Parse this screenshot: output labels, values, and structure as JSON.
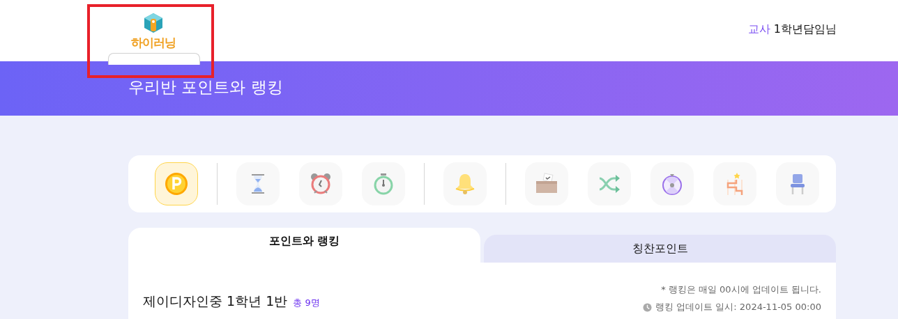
{
  "header": {
    "logo_text": "하이러닝",
    "role": "교사",
    "user": "1학년담임님"
  },
  "annotation": {
    "kind": "highlight-frame"
  },
  "banner": {
    "title": "우리반 포인트와 랭킹"
  },
  "tool_groups": [
    [
      {
        "kind": "point",
        "selected": true
      }
    ],
    [
      {
        "kind": "hourglass",
        "selected": false
      },
      {
        "kind": "alarm",
        "selected": false
      },
      {
        "kind": "stopwatch",
        "selected": false
      }
    ],
    [
      {
        "kind": "bell",
        "selected": false
      }
    ],
    [
      {
        "kind": "ballot",
        "selected": false
      },
      {
        "kind": "shuffle",
        "selected": false
      },
      {
        "kind": "wheel",
        "selected": false
      },
      {
        "kind": "ladder",
        "selected": false
      },
      {
        "kind": "chair",
        "selected": false
      }
    ]
  ],
  "tabs": [
    {
      "label": "포인트와 랭킹",
      "selected": true
    },
    {
      "label": "칭찬포인트",
      "selected": false
    }
  ],
  "class_info": {
    "name": "제이디자인중 1학년 1반",
    "count": "총 9명"
  },
  "notes": {
    "schedule": "* 랭킹은 매일 00시에 업데이트 됩니다.",
    "updated": "랭킹 업데이트 일시: 2024-11-05 00:00"
  }
}
